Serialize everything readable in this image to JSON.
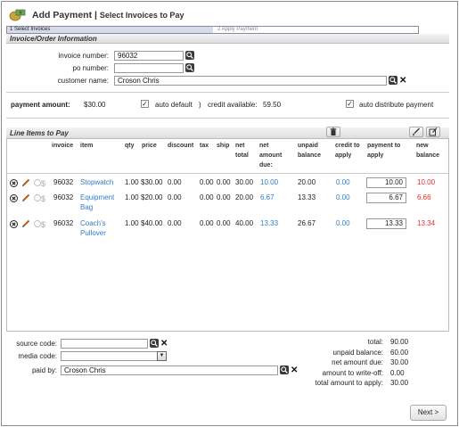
{
  "header": {
    "title": "Add Payment",
    "separator": "|",
    "subtitle": "Select Invoices to Pay"
  },
  "steps": {
    "step1": "1 Select Invoices",
    "step2": "2 Apply Payment"
  },
  "invoice_section": {
    "title": "Invoice/Order Information",
    "invoice_number_label": "invoice number:",
    "invoice_number_value": "96032",
    "po_number_label": "po number:",
    "po_number_value": "",
    "customer_name_label": "customer name:",
    "customer_name_value": "Croson Chris"
  },
  "payment": {
    "amount_label": "payment amount:",
    "amount_value": "$30.00",
    "auto_default_check": "✓",
    "auto_default_label": "auto default",
    "paren_close": ")",
    "credit_label": "credit available:",
    "credit_value": "59.50",
    "auto_distribute_check": "✓",
    "auto_distribute_label": "auto distribute payment"
  },
  "line_items": {
    "title": "Line Items to Pay",
    "columns": {
      "invoice": "invoice",
      "item": "item",
      "qty": "qty",
      "price": "price",
      "discount": "discount",
      "tax": "tax",
      "ship": "ship",
      "net_total": [
        "net",
        "total"
      ],
      "net_amount_due": [
        "net",
        "amount",
        "due:"
      ],
      "unpaid_balance": [
        "unpaid",
        "balance"
      ],
      "credit_to_apply": [
        "credit to",
        "apply"
      ],
      "payment_to_apply": [
        "payment to",
        "apply"
      ],
      "new_balance": [
        "new",
        "balance"
      ]
    },
    "rows": [
      {
        "invoice": "96032",
        "item": [
          "Stopwatch"
        ],
        "qty": "1.00",
        "price": "$30.00",
        "discount": "0.00",
        "tax": "0.00",
        "ship": "0.00",
        "net_total": "30.00",
        "net_due": "10.00",
        "unpaid": "20.00",
        "credit": "0.00",
        "payment": "10.00",
        "new_balance": "10.00"
      },
      {
        "invoice": "96032",
        "item": [
          "Equipment",
          "Bag"
        ],
        "qty": "1.00",
        "price": "$20.00",
        "discount": "0.00",
        "tax": "0.00",
        "ship": "0.00",
        "net_total": "20.00",
        "net_due": "6.67",
        "unpaid": "13.33",
        "credit": "0.00",
        "payment": "6.67",
        "new_balance": "6.66"
      },
      {
        "invoice": "96032",
        "item": [
          "Coach's",
          "Pullover"
        ],
        "qty": "1.00",
        "price": "$40.00",
        "discount": "0.00",
        "tax": "0.00",
        "ship": "0.00",
        "net_total": "40.00",
        "net_due": "13.33",
        "unpaid": "26.67",
        "credit": "0.00",
        "payment": "13.33",
        "new_balance": "13.34"
      }
    ]
  },
  "bottom": {
    "source_code_label": "source code:",
    "source_code_value": "",
    "media_code_label": "media code:",
    "media_code_value": "",
    "paid_by_label": "paid by:",
    "paid_by_value": "Croson Chris"
  },
  "summary": {
    "total_label": "total:",
    "total_value": "90.00",
    "unpaid_label": "unpaid balance:",
    "unpaid_value": "60.00",
    "net_due_label": "net amount due:",
    "net_due_value": "30.00",
    "writeoff_label": "amount to write-off:",
    "writeoff_value": "0.00",
    "apply_label": "total amount to apply:",
    "apply_value": "30.00"
  },
  "next_button": "Next >",
  "colors": {
    "link": "#2f7ec9",
    "negative": "#e03030",
    "step_active": "#d5dbe8"
  },
  "icons": [
    "payment-logo-icon",
    "search-icon",
    "clear-x-icon",
    "delete-icon",
    "edit-pencil-icon",
    "dollar-icon",
    "trash-icon",
    "brush-icon",
    "edit-note-icon",
    "chevron-down-icon"
  ]
}
